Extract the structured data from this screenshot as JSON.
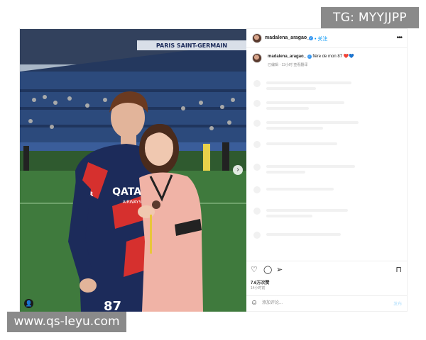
{
  "watermarks": {
    "top": "TG: MYYJJPP",
    "bottom": "www.qs-leyu.com"
  },
  "photo": {
    "stadium_sign": "PARIS SAINT-GERMAIN",
    "jersey_text": "QATAR",
    "jersey_subtext": "AIRWAYS",
    "jersey_number": "87",
    "sleeve_text": "AIR",
    "next_arrow": "›",
    "tag_icon": "👤"
  },
  "header": {
    "username": "madalena_aragao_",
    "verified_mark": "✓",
    "follow_label": "• 关注",
    "more_label": "•••"
  },
  "caption": {
    "username": "madalena_aragao_",
    "text": "fière de mon 87",
    "hearts": "❤️💙",
    "meta": "已编辑 · 13小时    查看翻译"
  },
  "actions": {
    "like_icon": "♡",
    "comment_icon": "◯",
    "share_icon": "➢",
    "save_icon": "⊓"
  },
  "likes": "7.6万次赞",
  "date": "14小时前",
  "comment": {
    "emoji": "☺",
    "placeholder": "添加评论...",
    "post_label": "发布"
  },
  "colors": {
    "link_blue": "#0095f6",
    "verified_blue": "#3897f0",
    "watermark_gray": "#8a8a8a",
    "psg_navy": "#1c2b5a",
    "psg_red": "#d6302e",
    "pink_jersey": "#f0b3a6",
    "pitch_green": "#3f7a3d"
  }
}
